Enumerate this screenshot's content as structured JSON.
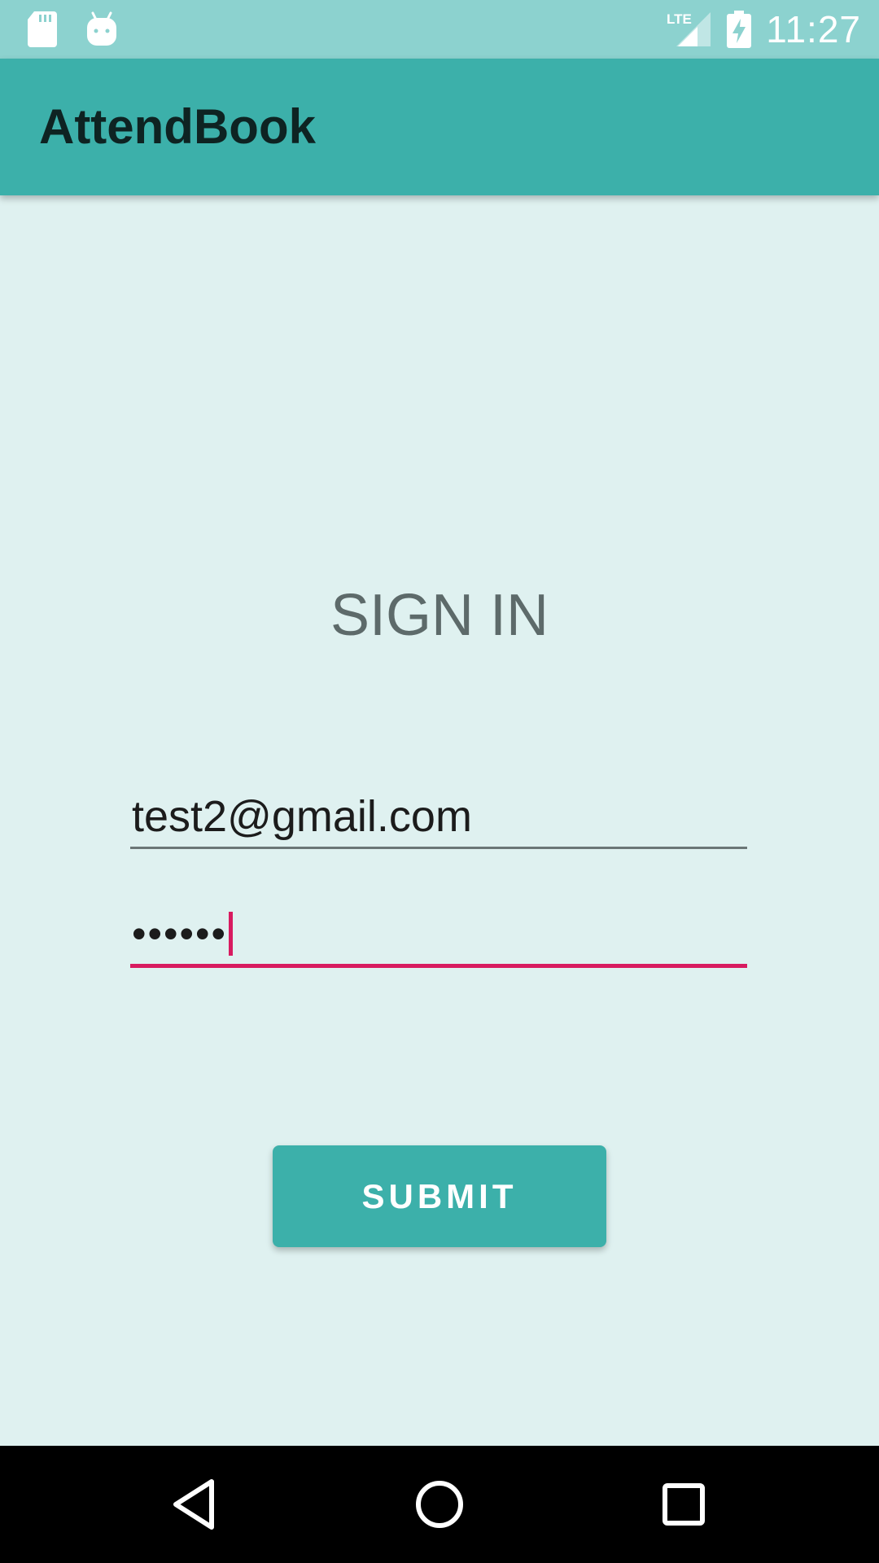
{
  "status_bar": {
    "time": "11:27",
    "network": "LTE",
    "icons": [
      "sd-card-icon",
      "android-icon",
      "signal-icon",
      "battery-charging-icon"
    ]
  },
  "app_bar": {
    "title": "AttendBook"
  },
  "form": {
    "heading": "SIGN IN",
    "email_value": "test2@gmail.com",
    "password_value": "••••••",
    "submit_label": "SUBMIT"
  },
  "nav_bar": {
    "icons": [
      "back-icon",
      "home-icon",
      "recents-icon"
    ]
  },
  "colors": {
    "primary": "#3cb0aa",
    "status_bar": "#8cd2cf",
    "background": "#dff1f0",
    "accent": "#d81b60"
  }
}
